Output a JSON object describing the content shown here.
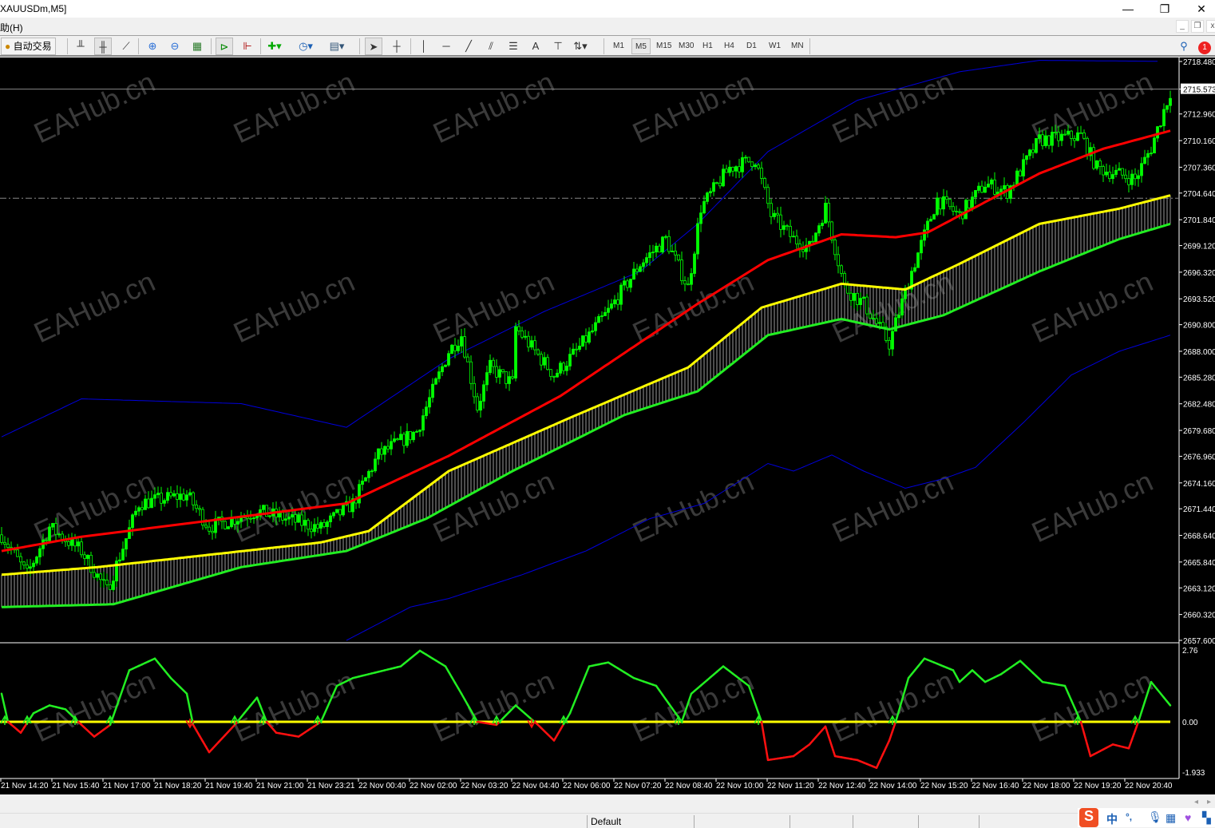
{
  "window": {
    "title": "XAUUSDm,M5]",
    "minimize": "—",
    "restore": "❐",
    "close": "✕"
  },
  "menu": {
    "help": "助(H)",
    "mdi_min": "_",
    "mdi_restore": "❐",
    "mdi_close": "x"
  },
  "toolbar": {
    "autotrade_label": "自动交易",
    "timeframes": [
      "M1",
      "M5",
      "M15",
      "M30",
      "H1",
      "H4",
      "D1",
      "W1",
      "MN"
    ],
    "active_timeframe": "M5",
    "notification_count": "1"
  },
  "chart_data": {
    "type": "candlestick",
    "symbol": "XAUUSDm",
    "timeframe": "M5",
    "bars": 369,
    "ylim": [
      2657.6,
      2718.48
    ],
    "price_ticks": [
      "2718.480",
      "2715.573",
      "2712.960",
      "2710.160",
      "2707.360",
      "2704.640",
      "2701.840",
      "2699.120",
      "2696.320",
      "2693.520",
      "2690.800",
      "2688.000",
      "2685.280",
      "2682.480",
      "2679.680",
      "2676.960",
      "2674.160",
      "2671.440",
      "2668.640",
      "2665.840",
      "2663.120",
      "2660.320",
      "2657.600"
    ],
    "current_price": 2715.573,
    "dashed_level": 2704.1,
    "close_path": [
      [
        0,
        2668.7
      ],
      [
        8,
        2664.5
      ],
      [
        15,
        2669.5
      ],
      [
        25,
        2667
      ],
      [
        33,
        2662.8
      ],
      [
        43,
        2672
      ],
      [
        58,
        2672.9
      ],
      [
        65,
        2669.5
      ],
      [
        80,
        2671.2
      ],
      [
        100,
        2669.4
      ],
      [
        110,
        2672
      ],
      [
        118,
        2677.1
      ],
      [
        130,
        2679.6
      ],
      [
        140,
        2688
      ],
      [
        144,
        2689.7
      ],
      [
        149,
        2682.1
      ],
      [
        153,
        2686.3
      ],
      [
        160,
        2684.6
      ],
      [
        161,
        2690.5
      ],
      [
        173,
        2685.5
      ],
      [
        180,
        2688
      ],
      [
        190,
        2692.2
      ],
      [
        200,
        2697.2
      ],
      [
        208,
        2699.8
      ],
      [
        215,
        2694.7
      ],
      [
        219,
        2703.1
      ],
      [
        228,
        2707.3
      ],
      [
        236,
        2708.2
      ],
      [
        241,
        2702.3
      ],
      [
        248,
        2699.8
      ],
      [
        253,
        2698.9
      ],
      [
        258,
        2703.1
      ],
      [
        264,
        2694.7
      ],
      [
        270,
        2693
      ],
      [
        278,
        2688.8
      ],
      [
        285,
        2696.4
      ],
      [
        293,
        2704
      ],
      [
        300,
        2702.3
      ],
      [
        308,
        2705.6
      ],
      [
        315,
        2704.8
      ],
      [
        325,
        2710.2
      ],
      [
        338,
        2710.7
      ],
      [
        343,
        2707.3
      ],
      [
        355,
        2706.1
      ],
      [
        360,
        2709.4
      ],
      [
        366,
        2715.3
      ]
    ],
    "ma_red": [
      [
        0,
        2667
      ],
      [
        25,
        2668.5
      ],
      [
        108,
        2672
      ],
      [
        140,
        2677
      ],
      [
        175,
        2683.3
      ],
      [
        218,
        2693
      ],
      [
        240,
        2697.6
      ],
      [
        263,
        2700.3
      ],
      [
        280,
        2700
      ],
      [
        290,
        2700.5
      ],
      [
        325,
        2706.7
      ],
      [
        345,
        2709.3
      ],
      [
        366,
        2711.2
      ]
    ],
    "ma_yellow": [
      [
        0,
        2664.5
      ],
      [
        30,
        2665.3
      ],
      [
        100,
        2667.9
      ],
      [
        115,
        2669.1
      ],
      [
        140,
        2675.4
      ],
      [
        180,
        2681.3
      ],
      [
        215,
        2686.3
      ],
      [
        238,
        2692.6
      ],
      [
        263,
        2695.1
      ],
      [
        283,
        2694.5
      ],
      [
        300,
        2697.2
      ],
      [
        325,
        2701.4
      ],
      [
        350,
        2703
      ],
      [
        366,
        2704.4
      ]
    ],
    "ma_green": [
      [
        0,
        2661.1
      ],
      [
        35,
        2661.4
      ],
      [
        75,
        2665.3
      ],
      [
        108,
        2667
      ],
      [
        133,
        2670.4
      ],
      [
        160,
        2675.4
      ],
      [
        195,
        2681.3
      ],
      [
        218,
        2683.8
      ],
      [
        240,
        2689.7
      ],
      [
        263,
        2691.4
      ],
      [
        278,
        2690.3
      ],
      [
        295,
        2691.8
      ],
      [
        325,
        2696.4
      ],
      [
        350,
        2699.8
      ],
      [
        366,
        2701.4
      ]
    ],
    "band_upper": [
      [
        0,
        2679
      ],
      [
        25,
        2683
      ],
      [
        75,
        2682.5
      ],
      [
        108,
        2680
      ],
      [
        140,
        2687.2
      ],
      [
        170,
        2692.2
      ],
      [
        200,
        2696.4
      ],
      [
        218,
        2701.4
      ],
      [
        240,
        2709
      ],
      [
        268,
        2714.4
      ],
      [
        300,
        2717.4
      ],
      [
        325,
        2718.6
      ],
      [
        362,
        2718.5
      ]
    ],
    "band_lower": [
      [
        108,
        2657.6
      ],
      [
        128,
        2661.1
      ],
      [
        140,
        2662
      ],
      [
        163,
        2664.5
      ],
      [
        183,
        2667
      ],
      [
        203,
        2670.4
      ],
      [
        220,
        2672
      ],
      [
        240,
        2676.2
      ],
      [
        248,
        2675.4
      ],
      [
        260,
        2677.1
      ],
      [
        270,
        2675.4
      ],
      [
        283,
        2673.6
      ],
      [
        295,
        2674.6
      ],
      [
        305,
        2675.8
      ],
      [
        320,
        2680.5
      ],
      [
        335,
        2685.5
      ],
      [
        350,
        2688
      ],
      [
        366,
        2689.7
      ]
    ],
    "oscillator": {
      "ylim": [
        -1.933,
        2.76
      ],
      "ticks": [
        "2.76",
        "0.00",
        "-1.933"
      ],
      "values": [
        [
          0,
          1.08
        ],
        [
          2,
          0
        ],
        [
          6,
          -0.42
        ],
        [
          10,
          0.33
        ],
        [
          15,
          0.63
        ],
        [
          20,
          0.48
        ],
        [
          24,
          0
        ],
        [
          29,
          -0.57
        ],
        [
          34,
          -0.12
        ],
        [
          40,
          1.98
        ],
        [
          48,
          2.43
        ],
        [
          53,
          1.68
        ],
        [
          58,
          1.08
        ],
        [
          60,
          -0.12
        ],
        [
          65,
          -1.17
        ],
        [
          73,
          -0.12
        ],
        [
          80,
          0.93
        ],
        [
          83,
          0
        ],
        [
          86,
          -0.42
        ],
        [
          93,
          -0.57
        ],
        [
          100,
          0
        ],
        [
          105,
          1.38
        ],
        [
          110,
          1.68
        ],
        [
          115,
          1.83
        ],
        [
          125,
          2.13
        ],
        [
          131,
          2.73
        ],
        [
          139,
          2.13
        ],
        [
          144,
          1.08
        ],
        [
          149,
          0
        ],
        [
          155,
          -0.12
        ],
        [
          161,
          0.63
        ],
        [
          168,
          -0.12
        ],
        [
          173,
          -0.72
        ],
        [
          178,
          0.33
        ],
        [
          184,
          2.13
        ],
        [
          190,
          2.28
        ],
        [
          198,
          1.68
        ],
        [
          205,
          1.38
        ],
        [
          213,
          0
        ],
        [
          216,
          1.08
        ],
        [
          226,
          2.13
        ],
        [
          234,
          1.38
        ],
        [
          238,
          0
        ],
        [
          240,
          -1.47
        ],
        [
          248,
          -1.32
        ],
        [
          253,
          -0.87
        ],
        [
          258,
          -0.18
        ],
        [
          261,
          -1.32
        ],
        [
          268,
          -1.47
        ],
        [
          274,
          -1.77
        ],
        [
          278,
          -0.72
        ],
        [
          280,
          0
        ],
        [
          284,
          1.68
        ],
        [
          289,
          2.43
        ],
        [
          298,
          1.98
        ],
        [
          300,
          1.53
        ],
        [
          304,
          1.98
        ],
        [
          308,
          1.53
        ],
        [
          313,
          1.83
        ],
        [
          319,
          2.34
        ],
        [
          326,
          1.53
        ],
        [
          333,
          1.38
        ],
        [
          338,
          0
        ],
        [
          341,
          -1.32
        ],
        [
          348,
          -0.87
        ],
        [
          353,
          -1.02
        ],
        [
          356,
          0
        ],
        [
          360,
          1.53
        ],
        [
          366,
          0.63
        ]
      ]
    },
    "time_labels": [
      "21 Nov 14:20",
      "21 Nov 15:40",
      "21 Nov 17:00",
      "21 Nov 18:20",
      "21 Nov 19:40",
      "21 Nov 21:00",
      "21 Nov 23:21",
      "22 Nov 00:40",
      "22 Nov 02:00",
      "22 Nov 03:20",
      "22 Nov 04:40",
      "22 Nov 06:00",
      "22 Nov 07:20",
      "22 Nov 08:40",
      "22 Nov 10:00",
      "22 Nov 11:20",
      "22 Nov 12:40",
      "22 Nov 14:00",
      "22 Nov 15:20",
      "22 Nov 16:40",
      "22 Nov 18:00",
      "22 Nov 19:20",
      "22 Nov 20:40"
    ],
    "watermark": "EAHub.cn",
    "colors": {
      "bull": "#00ff00",
      "ma_red": "#ff0000",
      "ma_yellow": "#ffff00",
      "ma_green": "#22ee22",
      "band": "#0000dd",
      "grid_text": "#ffffff"
    }
  },
  "status": {
    "profile": "Default"
  },
  "ime": {
    "logo": "S",
    "lang": "中",
    "punct": "°,"
  }
}
